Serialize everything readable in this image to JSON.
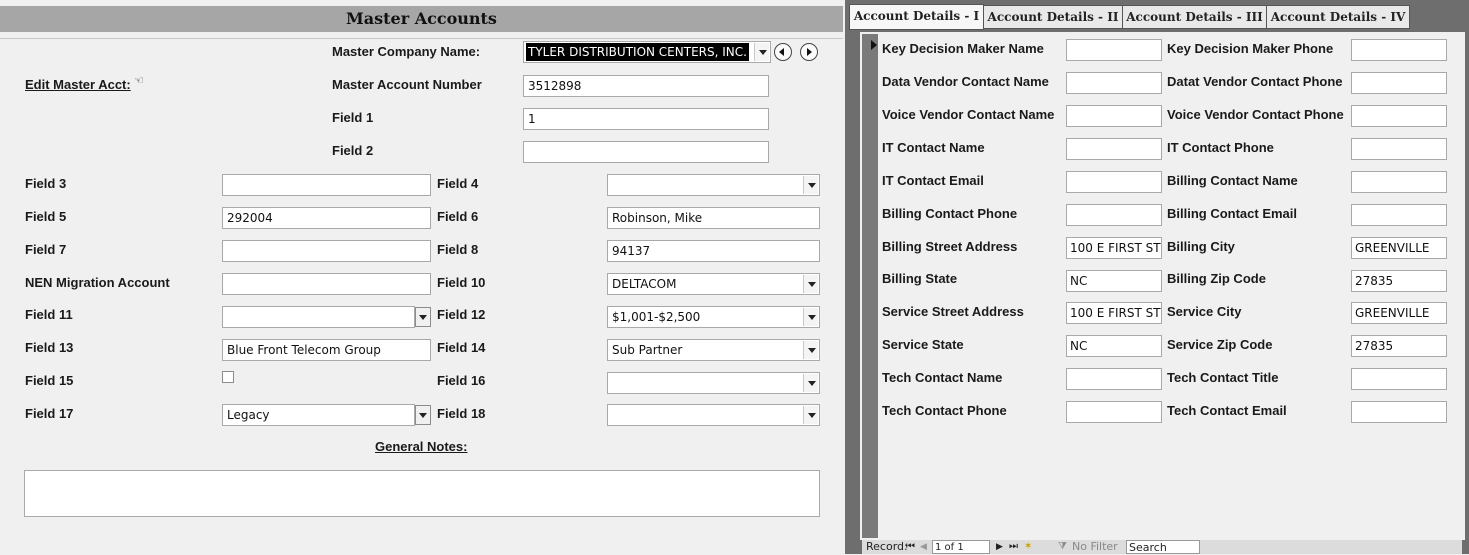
{
  "left": {
    "title": "Master Accounts",
    "edit_link": "Edit Master Acct:",
    "master_company_label": "Master Company Name:",
    "master_company_value": "TYLER DISTRIBUTION CENTERS, INC.",
    "master_account_label": "Master Account Number",
    "master_account_value": "3512898",
    "field1_label": "Field 1",
    "field1_value": "1",
    "field2_label": "Field 2",
    "field2_value": "",
    "field3_label": "Field 3",
    "field3_value": "",
    "field4_label": "Field 4",
    "field4_value": "",
    "field5_label": "Field 5",
    "field5_value": "292004",
    "field6_label": "Field 6",
    "field6_value": "Robinson, Mike",
    "field7_label": "Field 7",
    "field7_value": "",
    "field8_label": "Field 8",
    "field8_value": "94137",
    "nen_label": "NEN Migration Account",
    "nen_value": "",
    "field10_label": "Field 10",
    "field10_value": "DELTACOM",
    "field11_label": "Field 11",
    "field11_value": "",
    "field12_label": "Field 12",
    "field12_value": "$1,001-$2,500",
    "field13_label": "Field 13",
    "field13_value": "Blue Front Telecom Group",
    "field14_label": "Field 14",
    "field14_value": "Sub Partner",
    "field15_label": "Field 15",
    "field15_checked": false,
    "field16_label": "Field 16",
    "field16_value": "",
    "field17_label": "Field 17",
    "field17_value": "Legacy",
    "field18_label": "Field 18",
    "field18_value": "",
    "notes_label": "General Notes:",
    "notes_value": ""
  },
  "tabs": [
    {
      "label": "Account Details - I"
    },
    {
      "label": "Account Details - II"
    },
    {
      "label": "Account Details - III"
    },
    {
      "label": "Account Details - IV"
    }
  ],
  "details": {
    "key_dm_name_label": "Key Decision Maker Name",
    "key_dm_name_value": "",
    "key_dm_phone_label": "Key Decision Maker Phone",
    "key_dm_phone_value": "",
    "data_vendor_name_label": "Data Vendor Contact Name",
    "data_vendor_name_value": "",
    "data_vendor_phone_label": "Datat Vendor Contact Phone",
    "data_vendor_phone_value": "",
    "voice_vendor_name_label": "Voice Vendor Contact Name",
    "voice_vendor_name_value": "",
    "voice_vendor_phone_label": "Voice Vendor Contact Phone",
    "voice_vendor_phone_value": "",
    "it_name_label": "IT Contact Name",
    "it_name_value": "",
    "it_phone_label": "IT Contact Phone",
    "it_phone_value": "",
    "it_email_label": "IT Contact Email",
    "it_email_value": "",
    "billing_name_label": "Billing Contact Name",
    "billing_name_value": "",
    "billing_phone_label": "Billing Contact Phone",
    "billing_phone_value": "",
    "billing_email_label": "Billing Contact Email",
    "billing_email_value": "",
    "billing_street_label": "Billing Street Address",
    "billing_street_value": "100 E FIRST ST",
    "billing_city_label": "Billing City",
    "billing_city_value": "GREENVILLE",
    "billing_state_label": "Billing State",
    "billing_state_value": "NC",
    "billing_zip_label": "Billing Zip Code",
    "billing_zip_value": "27835",
    "service_street_label": "Service Street Address",
    "service_street_value": "100 E FIRST ST",
    "service_city_label": "Service City",
    "service_city_value": "GREENVILLE",
    "service_state_label": "Service State",
    "service_state_value": "NC",
    "service_zip_label": "Service Zip Code",
    "service_zip_value": "27835",
    "tech_name_label": "Tech Contact Name",
    "tech_name_value": "",
    "tech_title_label": "Tech Contact Title",
    "tech_title_value": "",
    "tech_phone_label": "Tech Contact Phone",
    "tech_phone_value": "",
    "tech_email_label": "Tech Contact Email",
    "tech_email_value": ""
  },
  "status_bar": {
    "record_label": "Record:",
    "record_position": "1 of 1",
    "filter_label": "No Filter",
    "search_label": "Search"
  }
}
